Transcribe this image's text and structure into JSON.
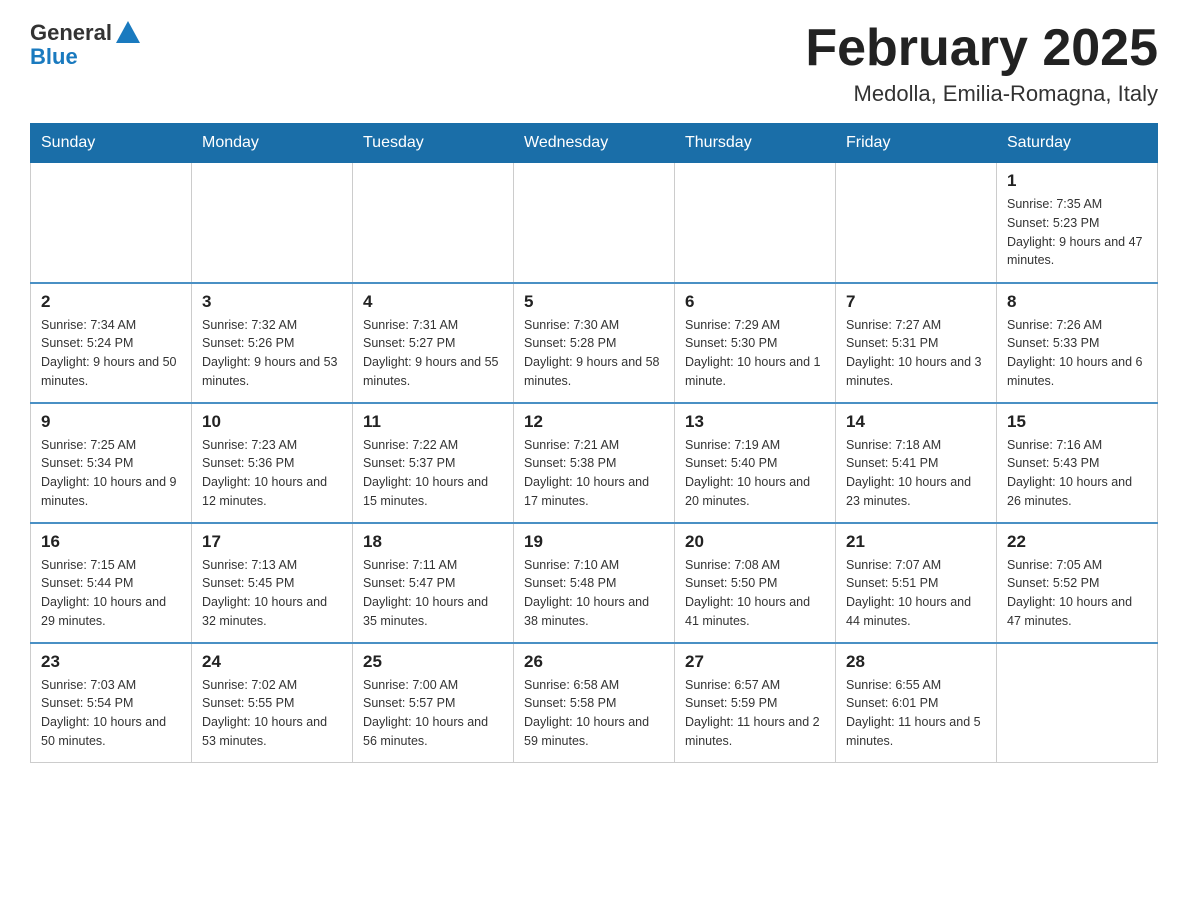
{
  "header": {
    "logo_general": "General",
    "logo_blue": "Blue",
    "month_title": "February 2025",
    "location": "Medolla, Emilia-Romagna, Italy"
  },
  "days_of_week": [
    "Sunday",
    "Monday",
    "Tuesday",
    "Wednesday",
    "Thursday",
    "Friday",
    "Saturday"
  ],
  "weeks": [
    [
      {
        "day": "",
        "info": ""
      },
      {
        "day": "",
        "info": ""
      },
      {
        "day": "",
        "info": ""
      },
      {
        "day": "",
        "info": ""
      },
      {
        "day": "",
        "info": ""
      },
      {
        "day": "",
        "info": ""
      },
      {
        "day": "1",
        "info": "Sunrise: 7:35 AM\nSunset: 5:23 PM\nDaylight: 9 hours and 47 minutes."
      }
    ],
    [
      {
        "day": "2",
        "info": "Sunrise: 7:34 AM\nSunset: 5:24 PM\nDaylight: 9 hours and 50 minutes."
      },
      {
        "day": "3",
        "info": "Sunrise: 7:32 AM\nSunset: 5:26 PM\nDaylight: 9 hours and 53 minutes."
      },
      {
        "day": "4",
        "info": "Sunrise: 7:31 AM\nSunset: 5:27 PM\nDaylight: 9 hours and 55 minutes."
      },
      {
        "day": "5",
        "info": "Sunrise: 7:30 AM\nSunset: 5:28 PM\nDaylight: 9 hours and 58 minutes."
      },
      {
        "day": "6",
        "info": "Sunrise: 7:29 AM\nSunset: 5:30 PM\nDaylight: 10 hours and 1 minute."
      },
      {
        "day": "7",
        "info": "Sunrise: 7:27 AM\nSunset: 5:31 PM\nDaylight: 10 hours and 3 minutes."
      },
      {
        "day": "8",
        "info": "Sunrise: 7:26 AM\nSunset: 5:33 PM\nDaylight: 10 hours and 6 minutes."
      }
    ],
    [
      {
        "day": "9",
        "info": "Sunrise: 7:25 AM\nSunset: 5:34 PM\nDaylight: 10 hours and 9 minutes."
      },
      {
        "day": "10",
        "info": "Sunrise: 7:23 AM\nSunset: 5:36 PM\nDaylight: 10 hours and 12 minutes."
      },
      {
        "day": "11",
        "info": "Sunrise: 7:22 AM\nSunset: 5:37 PM\nDaylight: 10 hours and 15 minutes."
      },
      {
        "day": "12",
        "info": "Sunrise: 7:21 AM\nSunset: 5:38 PM\nDaylight: 10 hours and 17 minutes."
      },
      {
        "day": "13",
        "info": "Sunrise: 7:19 AM\nSunset: 5:40 PM\nDaylight: 10 hours and 20 minutes."
      },
      {
        "day": "14",
        "info": "Sunrise: 7:18 AM\nSunset: 5:41 PM\nDaylight: 10 hours and 23 minutes."
      },
      {
        "day": "15",
        "info": "Sunrise: 7:16 AM\nSunset: 5:43 PM\nDaylight: 10 hours and 26 minutes."
      }
    ],
    [
      {
        "day": "16",
        "info": "Sunrise: 7:15 AM\nSunset: 5:44 PM\nDaylight: 10 hours and 29 minutes."
      },
      {
        "day": "17",
        "info": "Sunrise: 7:13 AM\nSunset: 5:45 PM\nDaylight: 10 hours and 32 minutes."
      },
      {
        "day": "18",
        "info": "Sunrise: 7:11 AM\nSunset: 5:47 PM\nDaylight: 10 hours and 35 minutes."
      },
      {
        "day": "19",
        "info": "Sunrise: 7:10 AM\nSunset: 5:48 PM\nDaylight: 10 hours and 38 minutes."
      },
      {
        "day": "20",
        "info": "Sunrise: 7:08 AM\nSunset: 5:50 PM\nDaylight: 10 hours and 41 minutes."
      },
      {
        "day": "21",
        "info": "Sunrise: 7:07 AM\nSunset: 5:51 PM\nDaylight: 10 hours and 44 minutes."
      },
      {
        "day": "22",
        "info": "Sunrise: 7:05 AM\nSunset: 5:52 PM\nDaylight: 10 hours and 47 minutes."
      }
    ],
    [
      {
        "day": "23",
        "info": "Sunrise: 7:03 AM\nSunset: 5:54 PM\nDaylight: 10 hours and 50 minutes."
      },
      {
        "day": "24",
        "info": "Sunrise: 7:02 AM\nSunset: 5:55 PM\nDaylight: 10 hours and 53 minutes."
      },
      {
        "day": "25",
        "info": "Sunrise: 7:00 AM\nSunset: 5:57 PM\nDaylight: 10 hours and 56 minutes."
      },
      {
        "day": "26",
        "info": "Sunrise: 6:58 AM\nSunset: 5:58 PM\nDaylight: 10 hours and 59 minutes."
      },
      {
        "day": "27",
        "info": "Sunrise: 6:57 AM\nSunset: 5:59 PM\nDaylight: 11 hours and 2 minutes."
      },
      {
        "day": "28",
        "info": "Sunrise: 6:55 AM\nSunset: 6:01 PM\nDaylight: 11 hours and 5 minutes."
      },
      {
        "day": "",
        "info": ""
      }
    ]
  ]
}
